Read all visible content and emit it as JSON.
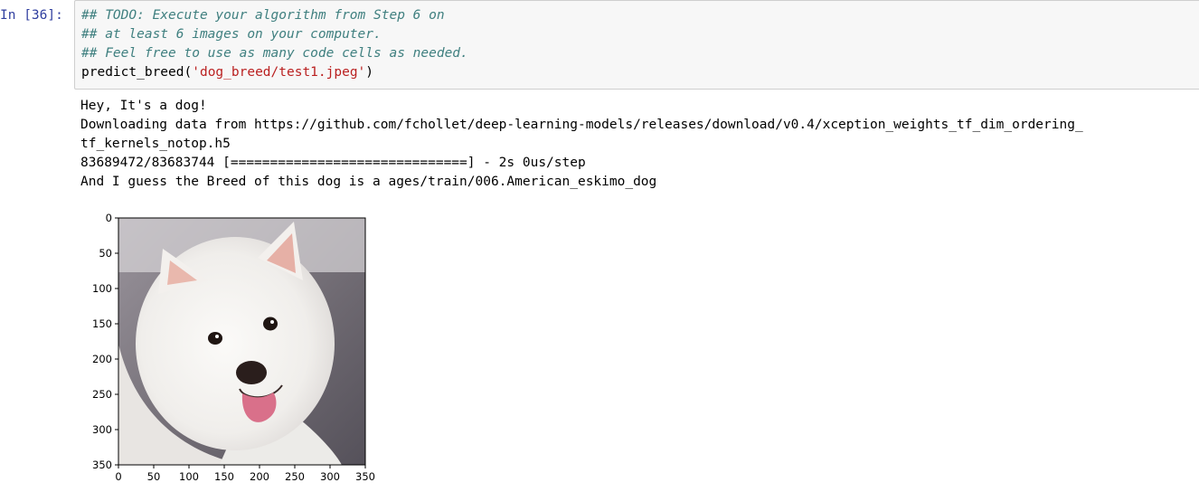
{
  "cell": {
    "prompt": "In [36]:",
    "code_lines": [
      {
        "kind": "comment",
        "text": "## TODO: Execute your algorithm from Step 6 on"
      },
      {
        "kind": "comment",
        "text": "## at least 6 images on your computer."
      },
      {
        "kind": "comment",
        "text": "## Feel free to use as many code cells as needed."
      }
    ],
    "call": {
      "fn": "predict_breed",
      "open": "(",
      "arg": "'dog_breed/test1.jpeg'",
      "close": ")"
    }
  },
  "output": {
    "lines": [
      "Hey, It's a dog!",
      "Downloading data from https://github.com/fchollet/deep-learning-models/releases/download/v0.4/xception_weights_tf_dim_ordering_",
      "tf_kernels_notop.h5",
      "83689472/83683744 [==============================] - 2s 0us/step",
      "And I guess the Breed of this dog is a ages/train/006.American_eskimo_dog"
    ]
  },
  "plot": {
    "image_description_icon": "dog-photo",
    "x_ticks": [
      "0",
      "50",
      "100",
      "150",
      "200",
      "250",
      "300",
      "350"
    ],
    "y_ticks": [
      "0",
      "50",
      "100",
      "150",
      "200",
      "250",
      "300",
      "350"
    ],
    "axis_range": [
      0,
      350
    ],
    "colors": {
      "fur": "#f4f2f0",
      "background": "#7f7a80",
      "nose": "#2a1e1c",
      "tongue": "#d9708a"
    }
  }
}
